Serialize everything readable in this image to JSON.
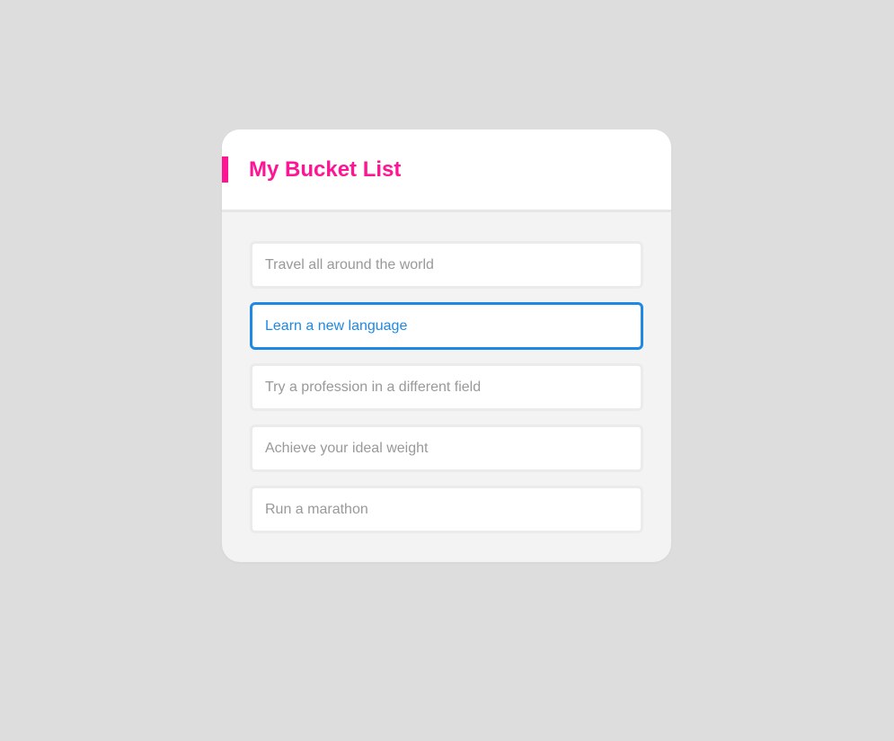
{
  "header": {
    "title": "My Bucket List",
    "accent_color": "#ff1493"
  },
  "list": {
    "active_index": 1,
    "active_color": "#1e88e5",
    "items": [
      {
        "label": "Travel all around the world"
      },
      {
        "label": "Learn a new language"
      },
      {
        "label": "Try a profession in a different field"
      },
      {
        "label": "Achieve your ideal weight"
      },
      {
        "label": "Run a marathon"
      }
    ]
  }
}
